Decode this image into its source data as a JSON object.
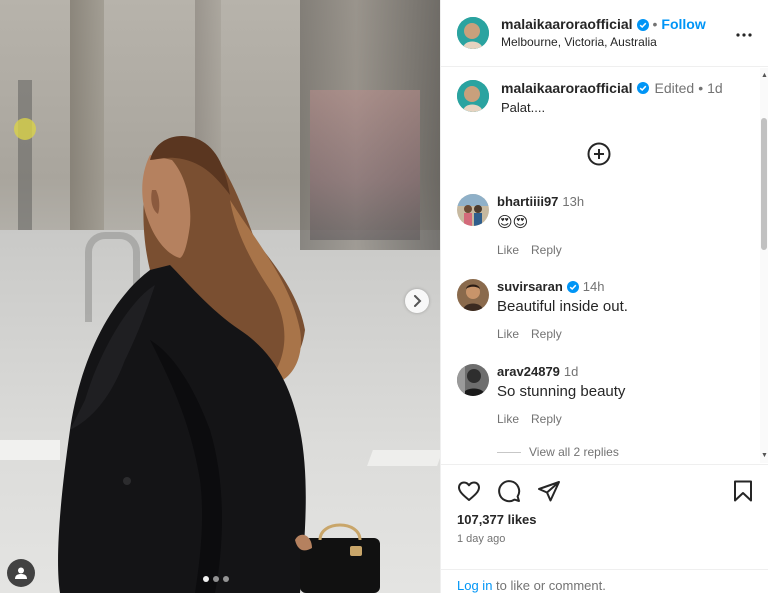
{
  "post": {
    "username": "malaikaaroraofficial",
    "follow_label": "Follow",
    "location": "Melbourne, Victoria, Australia",
    "separator": "•"
  },
  "caption": {
    "username": "malaikaaroraofficial",
    "edited_label": "Edited",
    "separator": "•",
    "time": "1d",
    "text": "Palat...."
  },
  "comments": [
    {
      "username": "bhartiiii97",
      "time": "13h",
      "text": "😍😍",
      "verified": false,
      "like_label": "Like",
      "reply_label": "Reply"
    },
    {
      "username": "suvirsaran",
      "time": "14h",
      "text": "Beautiful inside out.",
      "verified": true,
      "like_label": "Like",
      "reply_label": "Reply"
    },
    {
      "username": "arav24879",
      "time": "1d",
      "text": "So stunning beauty",
      "verified": false,
      "like_label": "Like",
      "reply_label": "Reply"
    }
  ],
  "view_replies_label": "View all 2 replies",
  "footer": {
    "likes": "107,377 likes",
    "time_ago": "1 day ago",
    "login_label": "Log in",
    "login_suffix": " to like or comment."
  },
  "icons": {
    "verified": "verified-badge-icon",
    "more": "more-options-icon",
    "load_more": "plus-circle-icon",
    "like": "heart-icon",
    "comment": "comment-icon",
    "share": "share-icon",
    "save": "bookmark-icon",
    "next": "chevron-right-icon",
    "tag": "user-tag-icon"
  },
  "colors": {
    "accent": "#0095f6",
    "secondary_text": "#737373",
    "primary_text": "#262626"
  }
}
